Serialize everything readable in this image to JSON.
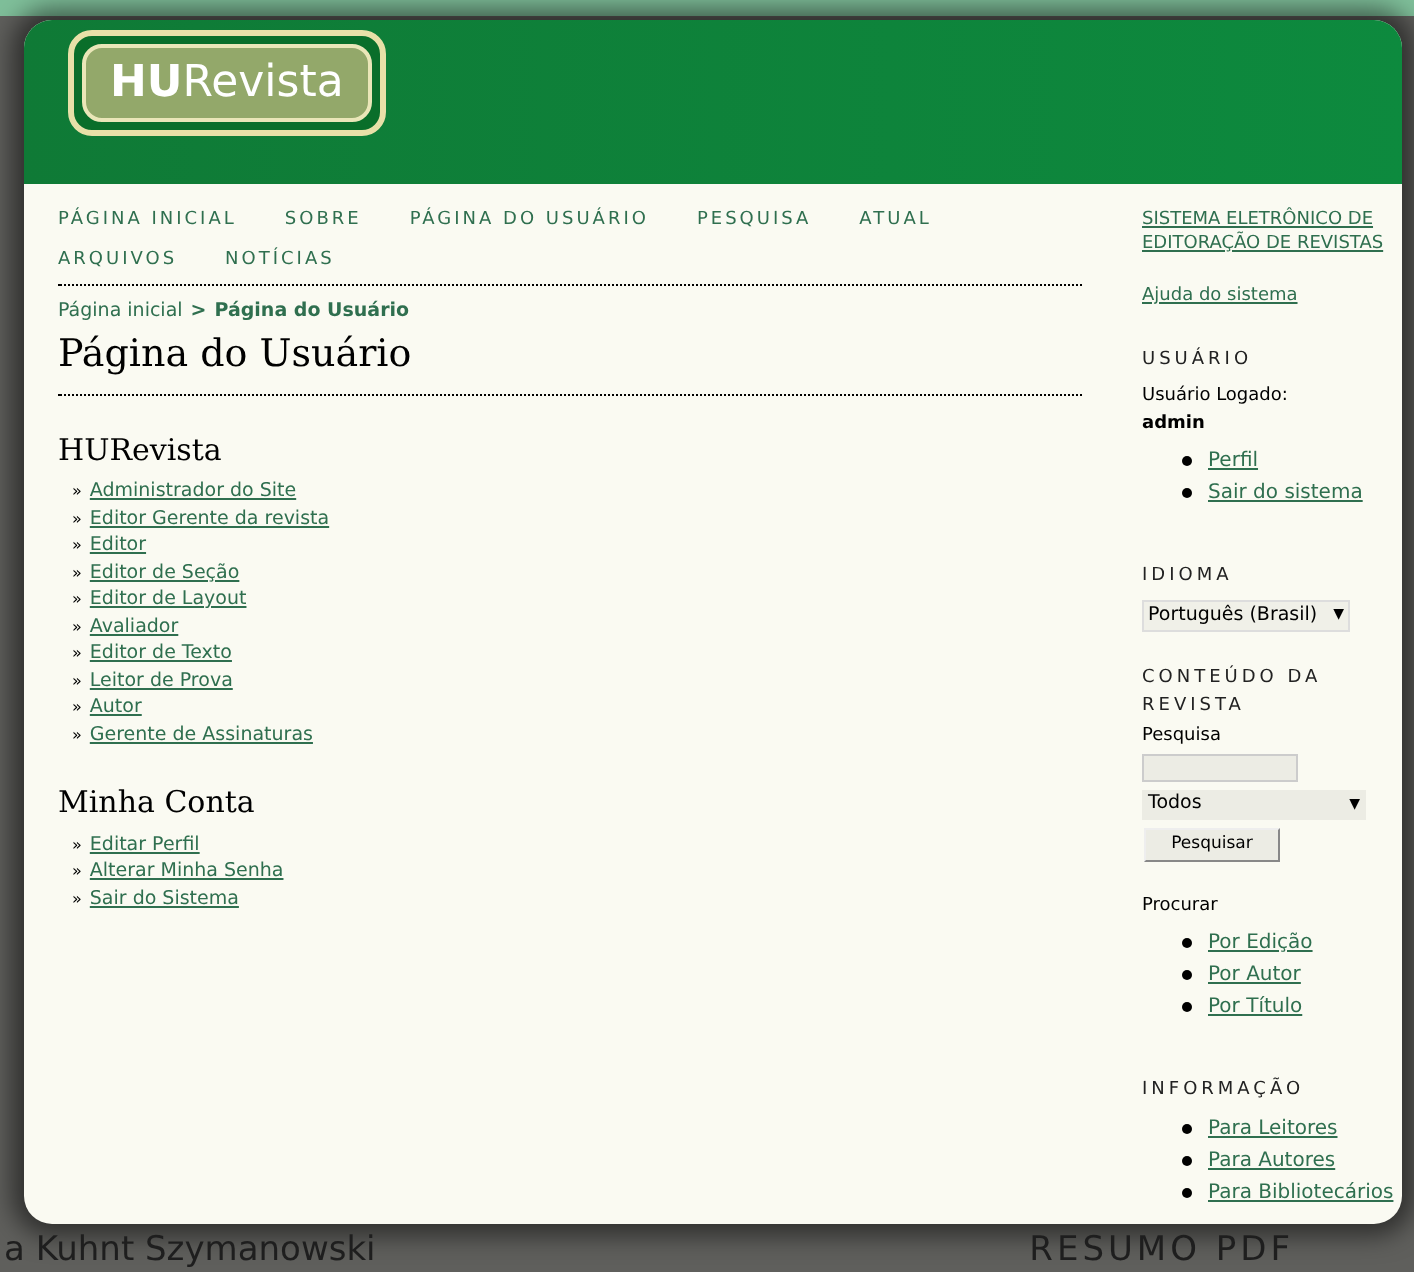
{
  "logo": {
    "bold": "HU",
    "rest": "Revista"
  },
  "nav": [
    "PÁGINA INICIAL",
    "SOBRE",
    "PÁGINA DO USUÁRIO",
    "PESQUISA",
    "ATUAL",
    "ARQUIVOS",
    "NOTÍCIAS"
  ],
  "breadcrumb": {
    "home": "Página inicial",
    "separator": ">",
    "current": "Página do Usuário"
  },
  "page_title": "Página do Usuário",
  "link_marker": "»",
  "dropdown_arrow": "▼",
  "sections": [
    {
      "title": "HURevista",
      "links": [
        "Administrador do Site",
        "Editor Gerente da revista",
        "Editor",
        "Editor de Seção",
        "Editor de Layout",
        "Avaliador",
        "Editor de Texto",
        "Leitor de Prova",
        "Autor",
        "Gerente de Assinaturas"
      ]
    },
    {
      "title": "Minha Conta",
      "links": [
        "Editar Perfil",
        "Alterar Minha Senha",
        "Sair do Sistema"
      ]
    }
  ],
  "sidebar": {
    "system_link": "SISTEMA ELETRÔNICO DE EDITORAÇÃO DE REVISTAS",
    "help_link": "Ajuda do sistema",
    "user": {
      "heading": "USUÁRIO",
      "logged_label": "Usuário Logado:",
      "username": "admin",
      "links": [
        "Perfil",
        "Sair do sistema"
      ]
    },
    "language": {
      "heading": "IDIOMA",
      "value": "Português (Brasil)"
    },
    "content": {
      "heading": "CONTEÚDO DA REVISTA",
      "search_label": "Pesquisa",
      "scope": "Todos",
      "button": "Pesquisar",
      "browse_label": "Procurar",
      "browse_links": [
        "Por Edição",
        "Por Autor",
        "Por Título"
      ]
    },
    "info": {
      "heading": "INFORMAÇÃO",
      "links": [
        "Para Leitores",
        "Para Autores",
        "Para Bibliotecários"
      ]
    }
  },
  "background_texts": [
    "a Kuhnt Szymanowski",
    "RESUMO PDF"
  ]
}
